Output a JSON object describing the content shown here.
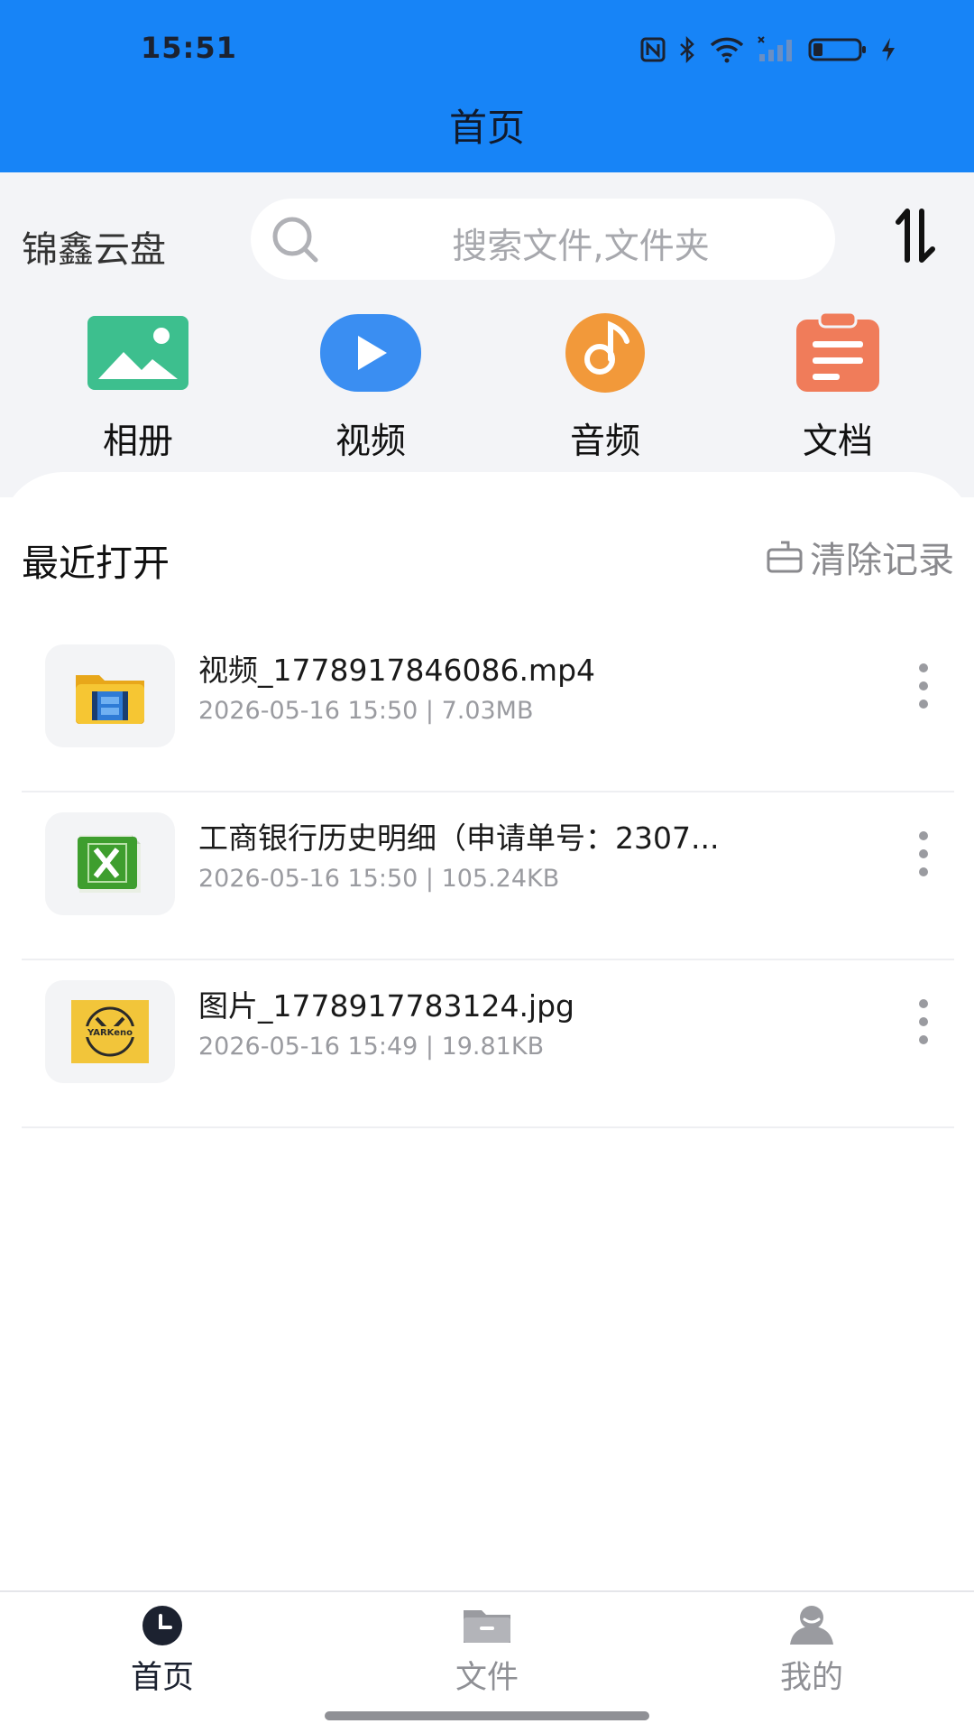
{
  "status_bar": {
    "time": "15:51"
  },
  "header": {
    "title": "首页"
  },
  "top": {
    "brand": "锦鑫云盘",
    "search_placeholder": "搜索文件,文件夹"
  },
  "categories": [
    {
      "label": "相册",
      "icon": "photo-album-icon",
      "color": "#3dbf8e"
    },
    {
      "label": "视频",
      "icon": "video-play-icon",
      "color": "#3a8ef2"
    },
    {
      "label": "音频",
      "icon": "music-disc-icon",
      "color": "#f2993a"
    },
    {
      "label": "文档",
      "icon": "clipboard-document-icon",
      "color": "#f07c5a"
    }
  ],
  "recent": {
    "title": "最近打开",
    "clear_label": "清除记录",
    "files": [
      {
        "name": "视频_1778917846086.mp4",
        "meta": "2026-05-16 15:50 | 7.03MB",
        "icon": "video-folder-icon"
      },
      {
        "name": "工商银行历史明细（申请单号：2307...",
        "meta": "2026-05-16 15:50 | 105.24KB",
        "icon": "excel-file-icon"
      },
      {
        "name": "图片_1778917783124.jpg",
        "meta": "2026-05-16 15:49 | 19.81KB",
        "icon": "image-thumbnail-icon",
        "thumb_text": "YARKeno"
      }
    ]
  },
  "nav": {
    "items": [
      {
        "label": "首页",
        "icon": "clock-icon",
        "active": true
      },
      {
        "label": "文件",
        "icon": "folder-icon",
        "active": false
      },
      {
        "label": "我的",
        "icon": "profile-icon",
        "active": false
      }
    ]
  },
  "colors": {
    "accent": "#1784f7",
    "active_nav": "#1c2230",
    "inactive_nav": "#8f9095"
  }
}
